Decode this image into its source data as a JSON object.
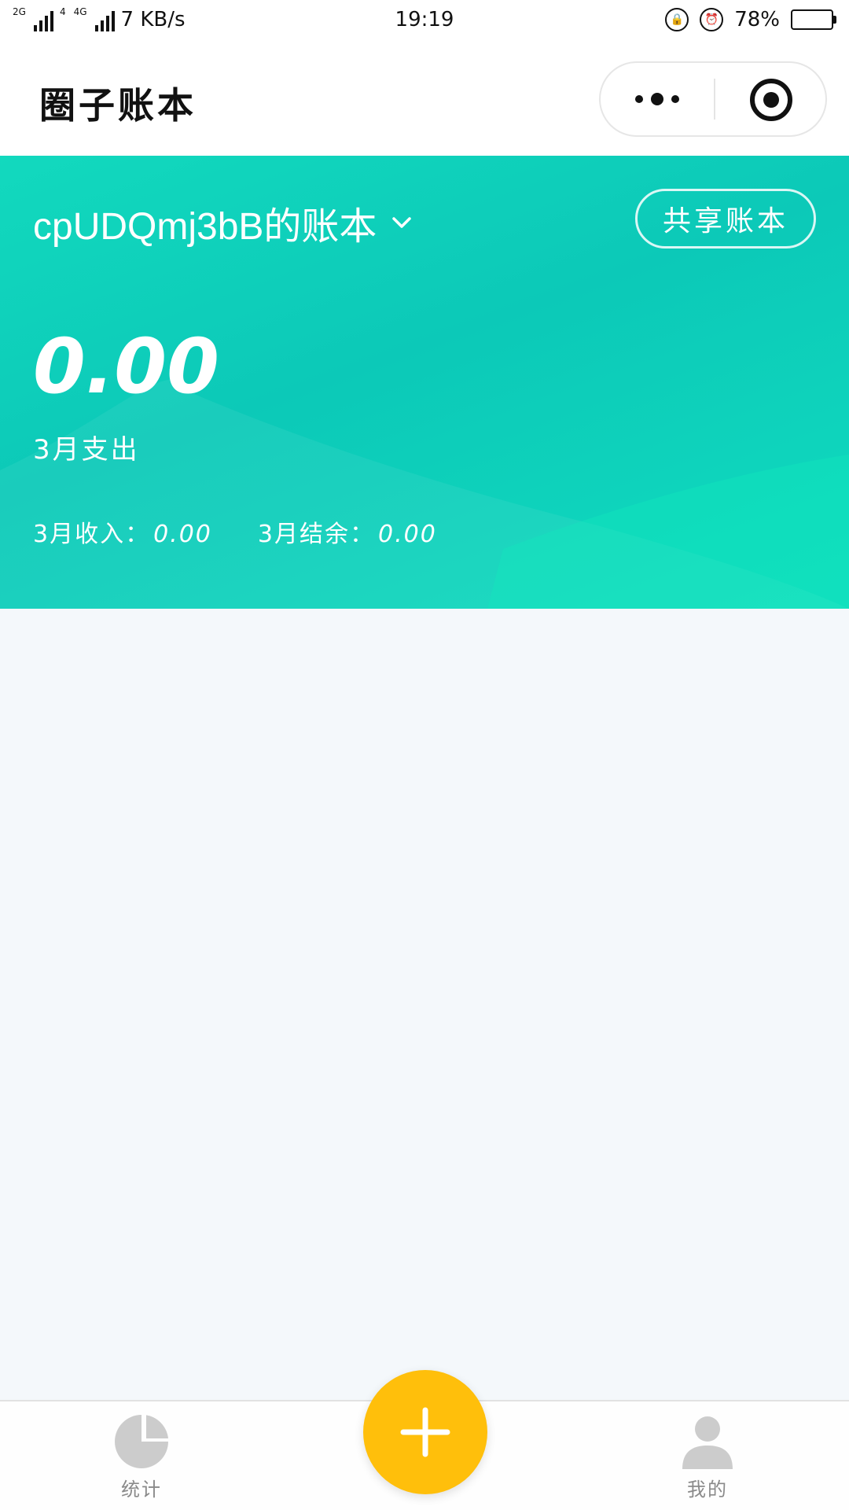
{
  "status_bar": {
    "network_2g": "2G",
    "network_4g": "4G",
    "network_sub": "4",
    "speed": "7 KB/s",
    "time": "19:19",
    "battery": "78%",
    "battery_level": 0.78
  },
  "header": {
    "title": "圈子账本"
  },
  "banner": {
    "book_name": "cpUDQmj3bB的账本",
    "share_label": "共享账本",
    "expense_amount": "0.00",
    "expense_label": "3月支出",
    "income_label": "3月收入：",
    "income_value": "0.00",
    "balance_label": "3月结余：",
    "balance_value": "0.00"
  },
  "tabbar": {
    "stats_label": "统计",
    "mine_label": "我的"
  },
  "colors": {
    "accent": "#12d9be",
    "add_button": "#ffbf0b",
    "background": "#f4f8fb",
    "tab_icon": "#cccccc",
    "battery_fill": "#3b9ef5"
  },
  "icons": {
    "stats": "pie-chart-icon",
    "add": "plus-icon",
    "mine": "user-icon",
    "chevron": "chevron-down-icon",
    "more": "more-dots-icon",
    "close": "target-close-icon"
  }
}
